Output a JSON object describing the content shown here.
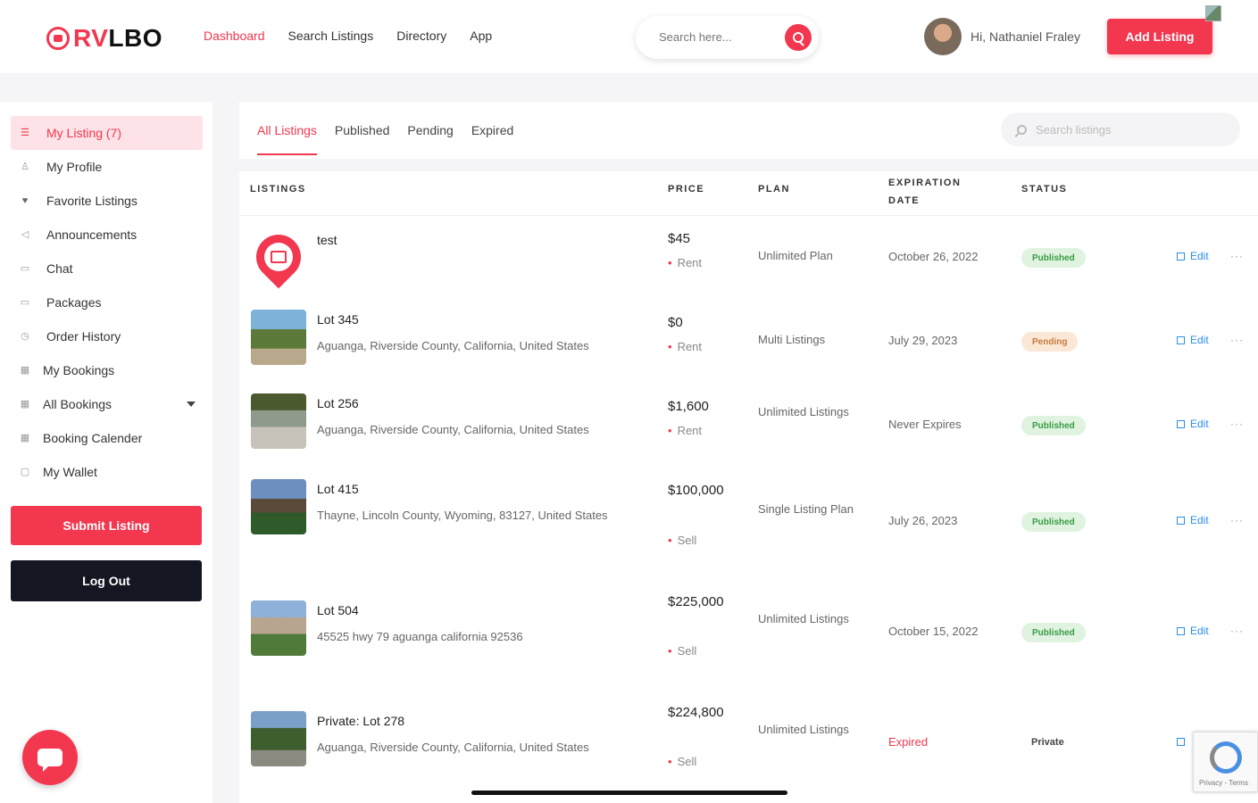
{
  "header": {
    "brand_rv": "RV",
    "brand_lbo": "LBO",
    "nav": [
      "Dashboard",
      "Search Listings",
      "Directory",
      "App"
    ],
    "active_nav": "Dashboard",
    "search_placeholder": "Search here...",
    "greeting": "Hi,  Nathaniel Fraley",
    "add_listing": "Add Listing"
  },
  "sidebar": {
    "items": [
      {
        "label": "My Listing (7)",
        "icon": "list-icon"
      },
      {
        "label": "My Profile",
        "icon": "user-icon"
      },
      {
        "label": "Favorite Listings",
        "icon": "heart-icon"
      },
      {
        "label": "Announcements",
        "icon": "megaphone-icon"
      },
      {
        "label": "Chat",
        "icon": "chat-icon"
      },
      {
        "label": "Packages",
        "icon": "package-icon"
      },
      {
        "label": "Order History",
        "icon": "clock-icon"
      },
      {
        "label": "My Bookings",
        "icon": "calendar-icon"
      },
      {
        "label": "All Bookings",
        "icon": "calendar-icon"
      },
      {
        "label": "Booking Calender",
        "icon": "calendar-icon"
      },
      {
        "label": "My Wallet",
        "icon": "wallet-icon"
      }
    ],
    "submit_listing": "Submit Listing",
    "log_out": "Log Out"
  },
  "main": {
    "tabs": [
      "All Listings",
      "Published",
      "Pending",
      "Expired"
    ],
    "search_placeholder": "Search listings",
    "columns": {
      "listings": "LISTINGS",
      "price": "PRICE",
      "plan": "PLAN",
      "expiration_1": "EXPIRATION",
      "expiration_2": "DATE",
      "status": "STATUS"
    },
    "edit_label": "Edit",
    "more_label": "···",
    "rows": [
      {
        "title": "test",
        "address": "",
        "price": "$45",
        "type": "Rent",
        "plan": "Unlimited Plan",
        "expiration": "October 26, 2022",
        "status": "Published"
      },
      {
        "title": "Lot 345",
        "address": "Aguanga, Riverside County, California, United States",
        "price": "$0",
        "type": "Rent",
        "plan": "Multi Listings",
        "expiration": "July 29, 2023",
        "status": "Pending"
      },
      {
        "title": "Lot 256",
        "address": "Aguanga, Riverside County, California, United States",
        "price": "$1,600",
        "type": "Rent",
        "plan": "Unlimited Listings",
        "expiration": "Never Expires",
        "status": "Published"
      },
      {
        "title": "Lot 415",
        "address": "Thayne, Lincoln County, Wyoming, 83127, United States",
        "price": "$100,000",
        "type": "Sell",
        "plan": "Single Listing Plan",
        "expiration": "July 26, 2023",
        "status": "Published"
      },
      {
        "title": "Lot 504",
        "address": "45525 hwy 79 aguanga california 92536",
        "price": "$225,000",
        "type": "Sell",
        "plan": "Unlimited Listings",
        "expiration": "October 15, 2022",
        "status": "Published"
      },
      {
        "title": "Private: Lot 278",
        "address": "Aguanga, Riverside County, California, United States",
        "price": "$224,800",
        "type": "Sell",
        "plan": "Unlimited Listings",
        "expiration": "Expired",
        "status": "Private"
      }
    ]
  },
  "recaptcha_text": "Privacy - Terms",
  "colors": {
    "accent": "#f2374f",
    "dark_button": "#141722",
    "published": "#3a9b44",
    "pending": "#c57b3d",
    "link": "#2b8de8"
  }
}
